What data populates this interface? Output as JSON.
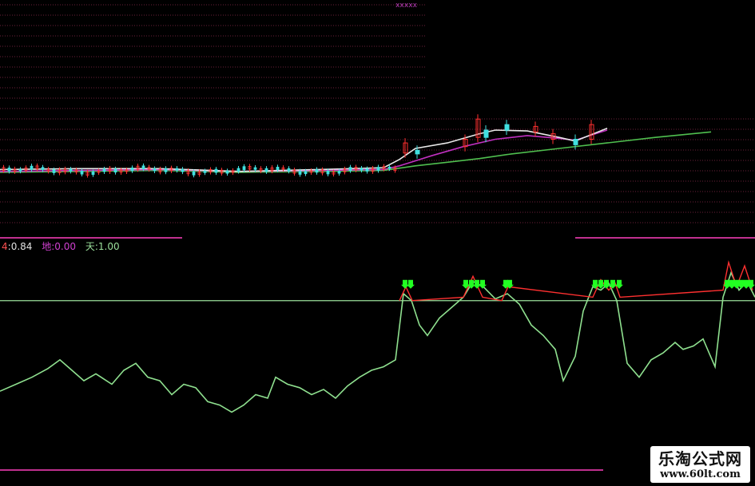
{
  "top_mark": "xxxxx",
  "legend": {
    "items": [
      {
        "key": "4",
        "sep": ":",
        "value": "0.84",
        "color": "#ff5050"
      },
      {
        "key": "地",
        "sep": ":",
        "value": "0.00",
        "color": "#d040d0"
      },
      {
        "key": "天",
        "sep": ":",
        "value": "1.00",
        "color": "#9be09b"
      }
    ]
  },
  "watermark": {
    "title": "乐淘公式网",
    "url": "www.60lt.com"
  },
  "colors": {
    "background": "#000000",
    "grid": "#6b1f3a",
    "divider": "#c0308f",
    "oscillator": "#8fe08f",
    "overbought_line": "#9be09b",
    "signal_red": "#ff3030",
    "arrow": "#22ff22",
    "ma_long": "#4fbf4f",
    "ma_mid": "#c030c0",
    "ma_short": "#e8e8e8",
    "ma_yellow": "#e0d060",
    "candle_up": "#ff3030",
    "candle_down": "#40e0e0"
  },
  "chart_data": [
    {
      "type": "line",
      "panel": "price",
      "series": [
        {
          "role": "long-moving-average",
          "color": "#4fbf4f",
          "x": [
            0,
            100,
            200,
            300,
            400,
            480,
            520,
            560,
            600,
            640,
            700,
            760,
            820,
            890
          ],
          "y": [
            0.34,
            0.35,
            0.36,
            0.34,
            0.35,
            0.36,
            0.41,
            0.45,
            0.49,
            0.54,
            0.6,
            0.66,
            0.72,
            0.78
          ]
        },
        {
          "role": "mid-moving-average",
          "color": "#c030c0",
          "x": [
            0,
            100,
            200,
            300,
            400,
            480,
            500,
            540,
            580,
            620,
            660,
            700,
            720,
            760
          ],
          "y": [
            0.35,
            0.36,
            0.37,
            0.35,
            0.36,
            0.37,
            0.41,
            0.52,
            0.62,
            0.7,
            0.74,
            0.71,
            0.69,
            0.8
          ]
        },
        {
          "role": "short-moving-average",
          "color": "#e8e8e8",
          "x": [
            0,
            100,
            200,
            300,
            400,
            480,
            500,
            520,
            560,
            600,
            620,
            660,
            700,
            720,
            760
          ],
          "y": [
            0.37,
            0.38,
            0.38,
            0.35,
            0.37,
            0.39,
            0.48,
            0.6,
            0.66,
            0.76,
            0.8,
            0.79,
            0.72,
            0.68,
            0.82
          ]
        }
      ],
      "candles": [
        {
          "x": 505,
          "open": 0.55,
          "close": 0.66
        },
        {
          "x": 520,
          "open": 0.58,
          "close": 0.54
        },
        {
          "x": 580,
          "open": 0.62,
          "close": 0.7
        },
        {
          "x": 596,
          "open": 0.72,
          "close": 0.92
        },
        {
          "x": 606,
          "open": 0.8,
          "close": 0.72
        },
        {
          "x": 632,
          "open": 0.86,
          "close": 0.8
        },
        {
          "x": 668,
          "open": 0.78,
          "close": 0.84
        },
        {
          "x": 690,
          "open": 0.7,
          "close": 0.76
        },
        {
          "x": 718,
          "open": 0.7,
          "close": 0.64
        },
        {
          "x": 738,
          "open": 0.7,
          "close": 0.86
        }
      ],
      "ylim": [
        0,
        1
      ]
    },
    {
      "type": "line",
      "panel": "oscillator",
      "reference_line": 0.84,
      "series": [
        {
          "role": "oscillator",
          "color": "#8fe08f",
          "x": [
            0,
            20,
            40,
            60,
            75,
            90,
            105,
            120,
            140,
            155,
            170,
            185,
            200,
            215,
            230,
            245,
            260,
            275,
            290,
            305,
            320,
            335,
            345,
            360,
            375,
            390,
            405,
            420,
            435,
            450,
            465,
            480,
            495,
            505,
            515,
            525,
            535,
            550,
            565,
            580,
            592,
            605,
            620,
            635,
            650,
            665,
            680,
            695,
            705,
            720,
            730,
            742,
            752,
            762,
            772,
            785,
            800,
            815,
            830,
            845,
            855,
            868,
            880,
            895,
            905,
            915,
            925,
            935,
            945
          ],
          "y": [
            0.32,
            0.36,
            0.4,
            0.45,
            0.5,
            0.44,
            0.38,
            0.42,
            0.36,
            0.44,
            0.48,
            0.4,
            0.38,
            0.3,
            0.36,
            0.34,
            0.26,
            0.24,
            0.2,
            0.24,
            0.3,
            0.28,
            0.4,
            0.36,
            0.34,
            0.3,
            0.33,
            0.28,
            0.35,
            0.4,
            0.44,
            0.46,
            0.5,
            0.88,
            0.84,
            0.7,
            0.64,
            0.74,
            0.8,
            0.86,
            0.95,
            0.92,
            0.85,
            0.88,
            0.82,
            0.7,
            0.64,
            0.56,
            0.38,
            0.52,
            0.78,
            0.92,
            0.9,
            0.94,
            0.84,
            0.48,
            0.4,
            0.5,
            0.54,
            0.6,
            0.56,
            0.58,
            0.62,
            0.46,
            0.86,
            1.0,
            0.9,
            0.95,
            0.86
          ]
        },
        {
          "role": "signal-peak",
          "color": "#ff3030",
          "x": [
            500,
            508,
            516,
            580,
            592,
            604,
            628,
            636,
            742,
            752,
            762,
            770,
            776,
            905,
            912,
            922,
            932,
            942
          ],
          "y": [
            0.84,
            0.92,
            0.84,
            0.86,
            0.98,
            0.86,
            0.84,
            0.92,
            0.86,
            0.96,
            0.9,
            0.94,
            0.86,
            0.9,
            1.06,
            0.92,
            1.04,
            0.9
          ]
        }
      ],
      "arrows_x": [
        507,
        514,
        583,
        590,
        597,
        604,
        633,
        638,
        745,
        752,
        759,
        767,
        775,
        910,
        916,
        922,
        928,
        934,
        940
      ],
      "ylim": [
        0,
        1.1
      ]
    }
  ]
}
